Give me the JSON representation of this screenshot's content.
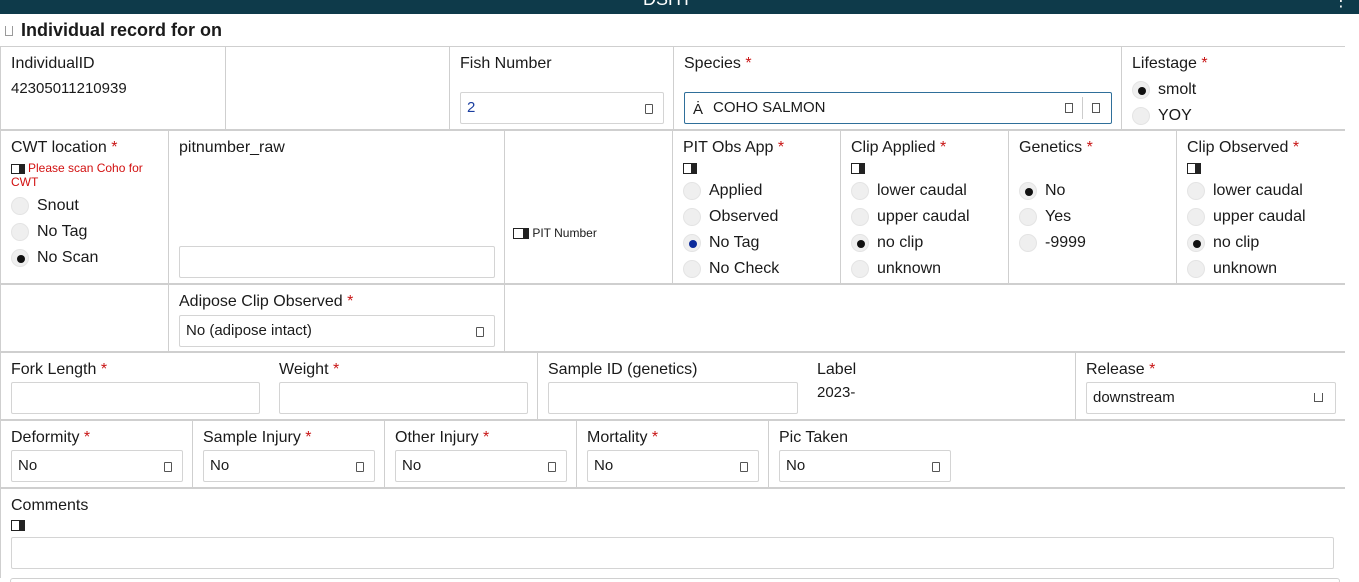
{
  "window": {
    "title": "DSHT",
    "menu_glyph": "⋮"
  },
  "section": {
    "title": "Individual record for on"
  },
  "row1": {
    "individual_id_label": "IndividualID",
    "individual_id_value": "42305011210939",
    "fish_number_label": "Fish Number",
    "fish_number_value": "2",
    "species_label": "Species",
    "species_value": "COHO SALMON",
    "lifestage_label": "Lifestage",
    "lifestage_options": [
      "smolt",
      "YOY"
    ],
    "lifestage_selected": "smolt"
  },
  "row2": {
    "cwt_label": "CWT location",
    "cwt_warning": "Please scan Coho for CWT",
    "cwt_options": [
      "Snout",
      "No Tag",
      "No Scan"
    ],
    "cwt_selected": "No Scan",
    "pitnumber_raw_label": "pitnumber_raw",
    "pitnumber_raw_value": "",
    "pit_number_button": "PIT Number",
    "pit_obs_label": "PIT Obs App",
    "pit_obs_options": [
      "Applied",
      "Observed",
      "No Tag",
      "No Check"
    ],
    "pit_obs_selected": "No Tag",
    "clip_applied_label": "Clip Applied",
    "clip_applied_options": [
      "lower caudal",
      "upper caudal",
      "no clip",
      "unknown"
    ],
    "clip_applied_selected": "no clip",
    "genetics_label": "Genetics",
    "genetics_options": [
      "No",
      "Yes",
      "-9999"
    ],
    "genetics_selected": "No",
    "clip_observed_label": "Clip Observed",
    "clip_observed_options": [
      "lower caudal",
      "upper caudal",
      "no clip",
      "unknown"
    ],
    "clip_observed_selected": "no clip"
  },
  "row3": {
    "adipose_label": "Adipose Clip Observed",
    "adipose_value": "No (adipose intact)"
  },
  "row4": {
    "fork_length_label": "Fork Length",
    "fork_length_value": "",
    "weight_label": "Weight",
    "weight_value": "",
    "sample_id_label": "Sample ID (genetics)",
    "sample_id_value": "",
    "label_label": "Label",
    "label_value": "2023-",
    "release_label": "Release",
    "release_value": "downstream"
  },
  "row5": {
    "deformity_label": "Deformity",
    "deformity_value": "No",
    "sample_injury_label": "Sample Injury",
    "sample_injury_value": "No",
    "other_injury_label": "Other Injury",
    "other_injury_value": "No",
    "mortality_label": "Mortality",
    "mortality_value": "No",
    "pic_taken_label": "Pic Taken",
    "pic_taken_value": "No"
  },
  "row6": {
    "comments_label": "Comments",
    "comments_value": ""
  },
  "required_marker": "*",
  "colors": {
    "header_bg": "#0e3a4a",
    "required": "#c81414",
    "warning": "#d21010",
    "focus_border": "#2f6f9a"
  }
}
